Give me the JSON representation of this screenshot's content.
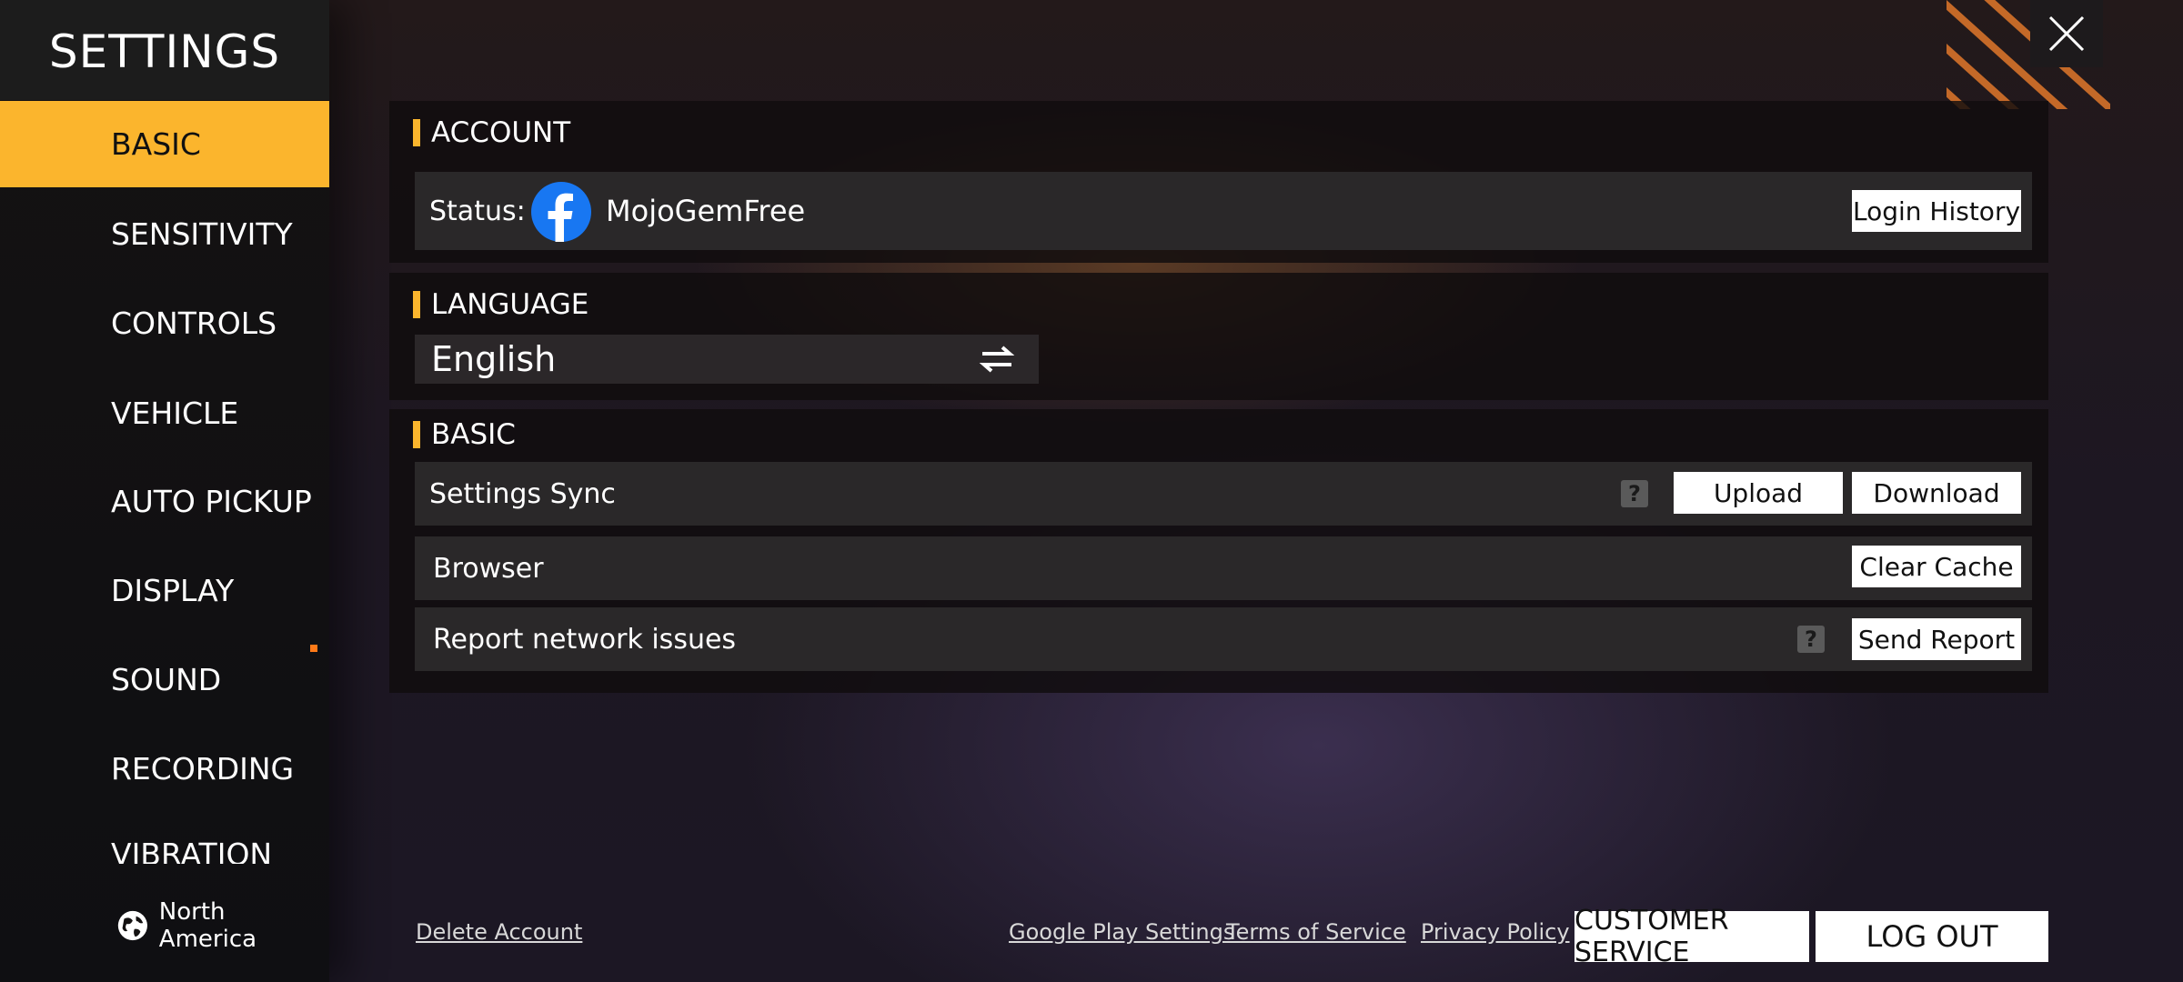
{
  "sidebar": {
    "title": "SETTINGS",
    "items": [
      {
        "label": "BASIC",
        "active": true
      },
      {
        "label": "SENSITIVITY"
      },
      {
        "label": "CONTROLS"
      },
      {
        "label": "VEHICLE"
      },
      {
        "label": "AUTO PICKUP"
      },
      {
        "label": "DISPLAY"
      },
      {
        "label": "SOUND"
      },
      {
        "label": "RECORDING"
      },
      {
        "label": "VIBRATION"
      }
    ],
    "region": "North America"
  },
  "account": {
    "header": "ACCOUNT",
    "status_label": "Status:",
    "username": "MojoGemFree",
    "login_history_button": "Login History"
  },
  "language": {
    "header": "LANGUAGE",
    "value": "English"
  },
  "basic": {
    "header": "BASIC",
    "settings_sync": {
      "label": "Settings Sync",
      "upload": "Upload",
      "download": "Download"
    },
    "browser": {
      "label": "Browser",
      "clear_cache": "Clear Cache"
    },
    "report": {
      "label": "Report network issues",
      "send_report": "Send Report"
    }
  },
  "footer": {
    "delete_account": "Delete Account",
    "google_play": "Google Play Settings",
    "terms": "Terms of Service",
    "privacy": "Privacy Policy",
    "customer_service": "CUSTOMER SERVICE",
    "log_out": "LOG OUT"
  },
  "colors": {
    "accent": "#fbb52d",
    "facebook": "#1877f2"
  }
}
